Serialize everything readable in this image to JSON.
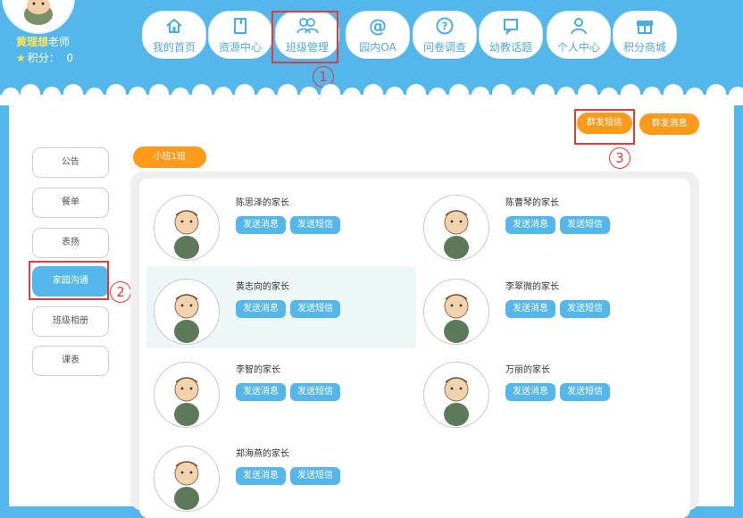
{
  "user": {
    "name": "黄理想",
    "role": "老师",
    "points_label": "积分：",
    "points": "0"
  },
  "nav": {
    "items": [
      {
        "label": "我的首页",
        "icon": "home-icon"
      },
      {
        "label": "资源中心",
        "icon": "document-icon"
      },
      {
        "label": "班级管理",
        "icon": "people-icon"
      },
      {
        "label": "园内OA",
        "icon": "at-icon"
      },
      {
        "label": "问卷调查",
        "icon": "question-icon"
      },
      {
        "label": "幼教话题",
        "icon": "chat-icon"
      },
      {
        "label": "个人中心",
        "icon": "person-icon"
      },
      {
        "label": "积分商城",
        "icon": "gift-icon"
      }
    ]
  },
  "markers": {
    "m1": "1",
    "m2": "2",
    "m3": "3"
  },
  "sidebar": {
    "items": [
      {
        "label": "公告"
      },
      {
        "label": "餐单"
      },
      {
        "label": "表扬"
      },
      {
        "label": "家园沟通"
      },
      {
        "label": "班级相册"
      },
      {
        "label": "课表"
      }
    ]
  },
  "actions": {
    "group_sms": "群发短信",
    "group_msg": "群发消息"
  },
  "class_tab": "小班1班",
  "parents": [
    {
      "name": "陈思泽的家长",
      "msg_btn": "发送消息",
      "sms_btn": "发送短信"
    },
    {
      "name": "陈曹琴的家长",
      "msg_btn": "发送消息",
      "sms_btn": "发送短信"
    },
    {
      "name": "黄志向的家长",
      "msg_btn": "发送消息",
      "sms_btn": "发送短信"
    },
    {
      "name": "李翠微的家长",
      "msg_btn": "发送消息",
      "sms_btn": "发送短信"
    },
    {
      "name": "李智的家长",
      "msg_btn": "发送消息",
      "sms_btn": "发送短信"
    },
    {
      "name": "万丽的家长",
      "msg_btn": "发送消息",
      "sms_btn": "发送短信"
    },
    {
      "name": "郑海燕的家长",
      "msg_btn": "发送消息",
      "sms_btn": "发送短信"
    }
  ],
  "colors": {
    "brand_blue": "#54b6ea",
    "accent_orange": "#ff9a1a",
    "annotation_red": "#e23b3b"
  }
}
